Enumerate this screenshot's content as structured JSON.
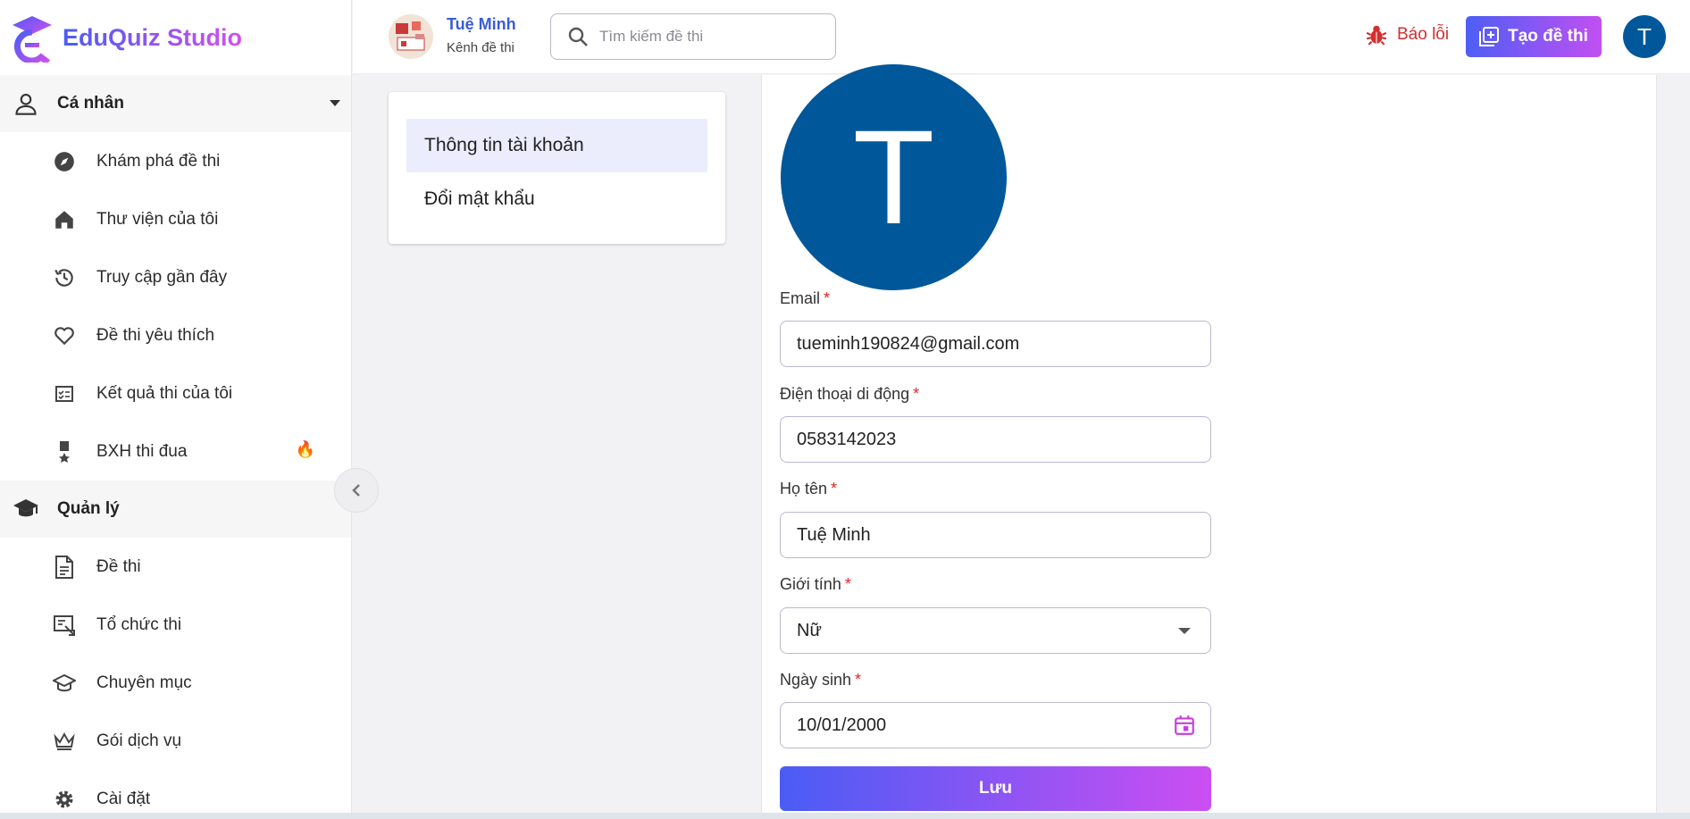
{
  "app": {
    "name": "EduQuiz Studio"
  },
  "sidebar": {
    "personal": {
      "label": "Cá nhân",
      "items": [
        {
          "label": "Khám phá đề thi",
          "icon": "compass-icon"
        },
        {
          "label": "Thư viện của tôi",
          "icon": "home-icon"
        },
        {
          "label": "Truy cập gần đây",
          "icon": "history-icon"
        },
        {
          "label": "Đề thi yêu thích",
          "icon": "heart-icon"
        },
        {
          "label": "Kết quả thi của tôi",
          "icon": "checklist-icon"
        },
        {
          "label": "BXH thi đua",
          "icon": "medal-icon",
          "badge": "🔥"
        }
      ]
    },
    "manage": {
      "label": "Quản lý",
      "items": [
        {
          "label": "Đề thi",
          "icon": "document-icon"
        },
        {
          "label": "Tổ chức thi",
          "icon": "organize-exam-icon"
        },
        {
          "label": "Chuyên mục",
          "icon": "graduation-cap-icon"
        },
        {
          "label": "Gói dịch vụ",
          "icon": "crown-icon"
        },
        {
          "label": "Cài đặt",
          "icon": "gear-icon"
        }
      ]
    }
  },
  "header": {
    "channel_name": "Tuệ Minh",
    "channel_sub": "Kênh đề thi",
    "search_placeholder": "Tìm kiếm đề thi",
    "report_label": "Báo lỗi",
    "create_label": "Tạo đề thi",
    "user_initial": "T"
  },
  "tabs": [
    {
      "label": "Thông tin tài khoản",
      "active": true
    },
    {
      "label": "Đổi mật khẩu",
      "active": false
    }
  ],
  "profile": {
    "avatar_initial": "T",
    "email_label": "Email",
    "email_value": "tueminh190824@gmail.com",
    "phone_label": "Điện thoại di động",
    "phone_value": "0583142023",
    "name_label": "Họ tên",
    "name_value": "Tuệ Minh",
    "gender_label": "Giới tính",
    "gender_value": "Nữ",
    "dob_label": "Ngày sinh",
    "dob_value": "10/01/2000",
    "required_mark": "*",
    "save_label": "Lưu"
  },
  "colors": {
    "brand_gradient_start": "#4a5cf5",
    "brand_gradient_end": "#cc4ef2",
    "avatar_bg": "#00579a",
    "error_red": "#d32f2f"
  }
}
